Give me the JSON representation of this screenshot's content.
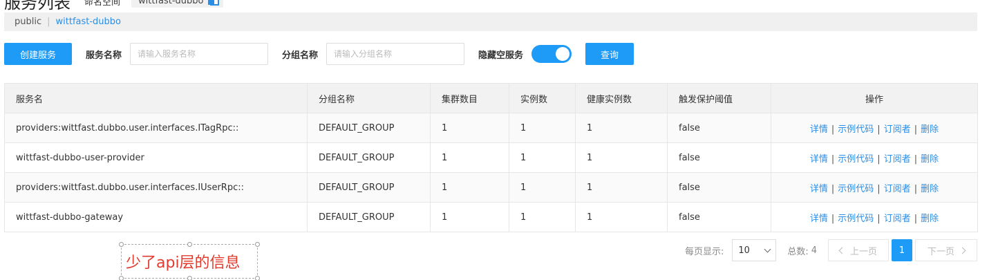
{
  "header": {
    "title": "服务列表",
    "namespace_label": "命名空间",
    "namespace_tag": "wittfast-dubbo",
    "copy_icon": "copy-icon"
  },
  "namespace_bar": {
    "items": [
      "public",
      "wittfast-dubbo"
    ],
    "active": "wittfast-dubbo"
  },
  "toolbar": {
    "create_label": "创建服务",
    "service_name_label": "服务名称",
    "service_name_placeholder": "请输入服务名称",
    "group_name_label": "分组名称",
    "group_name_placeholder": "请输入分组名称",
    "hide_empty_label": "隐藏空服务",
    "hide_empty_on": true,
    "query_label": "查询"
  },
  "table": {
    "columns": [
      "服务名",
      "分组名称",
      "集群数目",
      "实例数",
      "健康实例数",
      "触发保护阈值",
      "操作"
    ],
    "rows": [
      {
        "name": "providers:wittfast.dubbo.user.interfaces.ITagRpc::",
        "group": "DEFAULT_GROUP",
        "clusters": "1",
        "instances": "1",
        "healthy": "1",
        "threshold": "false"
      },
      {
        "name": "wittfast-dubbo-user-provider",
        "group": "DEFAULT_GROUP",
        "clusters": "1",
        "instances": "1",
        "healthy": "1",
        "threshold": "false"
      },
      {
        "name": "providers:wittfast.dubbo.user.interfaces.IUserRpc::",
        "group": "DEFAULT_GROUP",
        "clusters": "1",
        "instances": "1",
        "healthy": "1",
        "threshold": "false"
      },
      {
        "name": "wittfast-dubbo-gateway",
        "group": "DEFAULT_GROUP",
        "clusters": "1",
        "instances": "1",
        "healthy": "1",
        "threshold": "false"
      }
    ],
    "actions": [
      "详情",
      "示例代码",
      "订阅者",
      "删除"
    ],
    "action_separator": "|"
  },
  "pagination": {
    "per_page_label": "每页显示:",
    "per_page_value": "10",
    "total_label": "总数:",
    "total_value": "4",
    "prev_label": "上一页",
    "next_label": "下一页",
    "current_page": "1"
  },
  "annotation": {
    "text": "少了api层的信息",
    "color": "#e23b2e"
  },
  "colors": {
    "primary": "#1e9af7",
    "link": "#2b8ee6"
  }
}
